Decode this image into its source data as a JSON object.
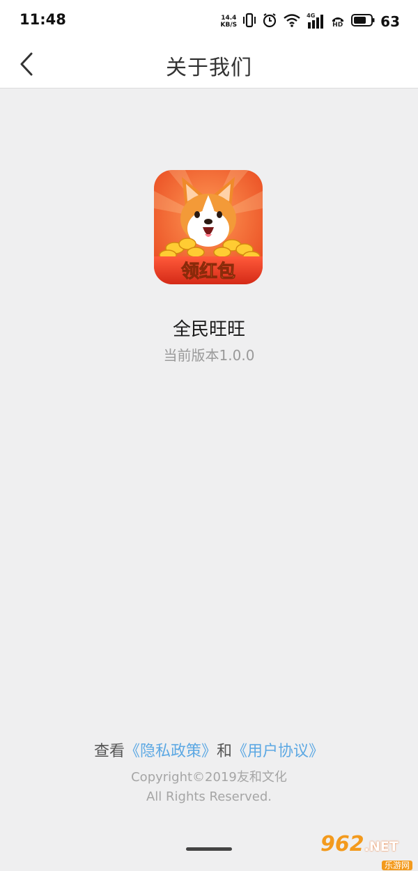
{
  "status_bar": {
    "time": "11:48",
    "net_speed_value": "14.4",
    "net_speed_unit": "KB/S",
    "signal_label": "4G",
    "hd_label": "HD",
    "battery": "63",
    "icons": [
      "vibrate-icon",
      "alarm-icon",
      "wifi-icon",
      "cell-signal-icon",
      "hd-call-icon",
      "battery-icon"
    ]
  },
  "nav": {
    "back_icon": "chevron-left-icon",
    "title": "关于我们"
  },
  "app": {
    "icon_badge_text": "领红包",
    "name": "全民旺旺",
    "version": "当前版本1.0.0"
  },
  "footer": {
    "prefix": "查看",
    "privacy_link": "《隐私政策》",
    "and": "和",
    "agreement_link": "《用户协议》",
    "copyright_line1": "Copyright©2019友和文化",
    "copyright_line2": "All Rights Reserved."
  },
  "watermark": {
    "number": "962",
    "suffix": ".NET",
    "subtitle": "乐游网"
  },
  "colors": {
    "background": "#efeff0",
    "link": "#5ca8e3",
    "icon_orange": "#f26a2d"
  }
}
